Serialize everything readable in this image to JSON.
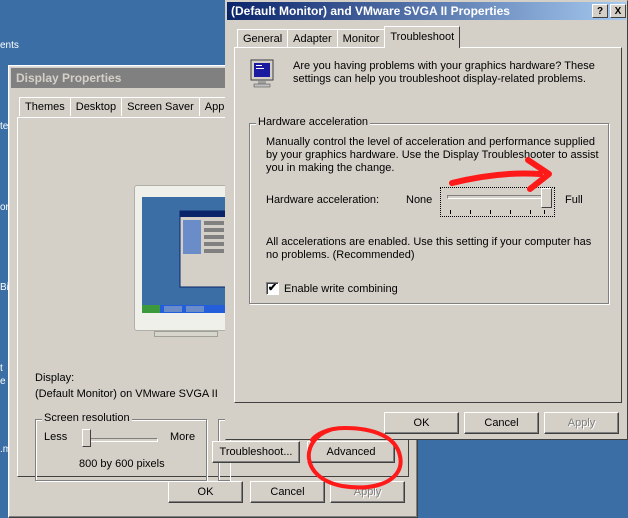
{
  "desktop": {
    "fragments": [
      "ents",
      "te",
      "orl",
      "Bin",
      "t",
      "e",
      ".m"
    ]
  },
  "display_properties": {
    "title": "Display Properties",
    "tabs": [
      "Themes",
      "Desktop",
      "Screen Saver",
      "App"
    ],
    "display_label": "Display:",
    "display_value": "(Default Monitor) on VMware SVGA II",
    "screen_resolution": {
      "title": "Screen resolution",
      "less": "Less",
      "more": "More",
      "value": "800 by 600 pixels"
    },
    "buttons": {
      "troubleshoot": "Troubleshoot...",
      "advanced": "Advanced",
      "ok": "OK",
      "cancel": "Cancel",
      "apply": "Apply"
    }
  },
  "advanced_properties": {
    "title": "(Default Monitor) and VMware SVGA II Properties",
    "help_glyph": "?",
    "close_glyph": "X",
    "tabs": [
      "General",
      "Adapter",
      "Monitor",
      "Troubleshoot"
    ],
    "active_tab": "Troubleshoot",
    "intro": "Are you having problems with your graphics hardware? These settings can help you troubleshoot display-related problems.",
    "group_title": "Hardware acceleration",
    "group_desc": "Manually control the level of acceleration and performance supplied by your graphics hardware. Use the Display Troubleshooter to assist you in making the change.",
    "slider_label": "Hardware acceleration:",
    "slider_min": "None",
    "slider_max": "Full",
    "slider_level": 1.0,
    "status": "All accelerations are enabled. Use this setting if your computer has no problems. (Recommended)",
    "write_combining_label": "Enable write combining",
    "write_combining_checked": true,
    "checkmark_glyph": "✔",
    "buttons": {
      "ok": "OK",
      "cancel": "Cancel",
      "apply": "Apply"
    }
  },
  "colors": {
    "desktop": "#3a6ea5",
    "active_title_start": "#0a246a",
    "annotation_red": "#ff1a1a"
  },
  "icons": [
    "monitor-icon",
    "help-icon",
    "close-icon",
    "checkmark-icon",
    "red-arrow-annotation",
    "red-circle-annotation"
  ]
}
